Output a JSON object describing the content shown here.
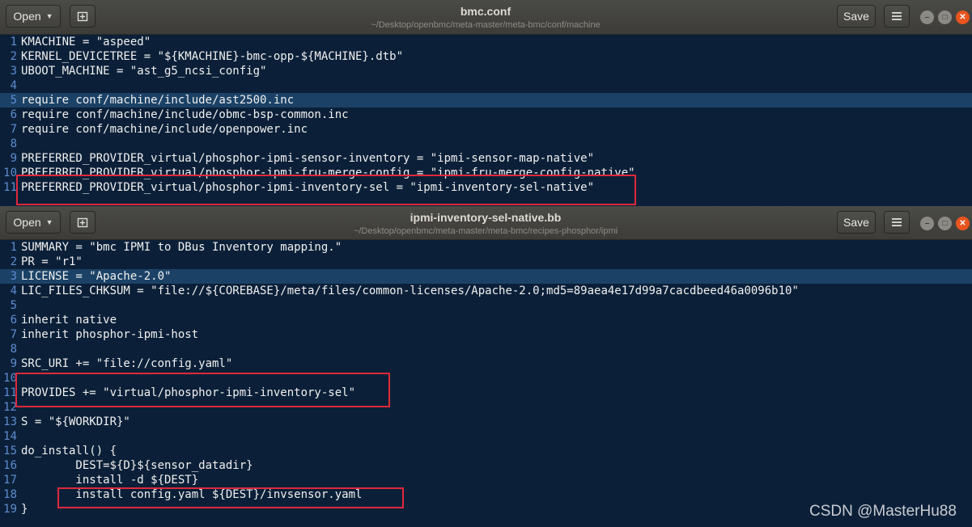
{
  "top_window": {
    "open_label": "Open",
    "title": "bmc.conf",
    "path": "~/Desktop/openbmc/meta-master/meta-bmc/conf/machine",
    "save_label": "Save",
    "lines": [
      {
        "num": "1",
        "text": "KMACHINE = \"aspeed\""
      },
      {
        "num": "2",
        "text": "KERNEL_DEVICETREE = \"${KMACHINE}-bmc-opp-${MACHINE}.dtb\""
      },
      {
        "num": "3",
        "text": "UBOOT_MACHINE = \"ast_g5_ncsi_config\""
      },
      {
        "num": "4",
        "text": ""
      },
      {
        "num": "5",
        "text": "require conf/machine/include/ast2500.inc",
        "current": true
      },
      {
        "num": "6",
        "text": "require conf/machine/include/obmc-bsp-common.inc"
      },
      {
        "num": "7",
        "text": "require conf/machine/include/openpower.inc"
      },
      {
        "num": "8",
        "text": ""
      },
      {
        "num": "9",
        "text": "PREFERRED_PROVIDER_virtual/phosphor-ipmi-sensor-inventory = \"ipmi-sensor-map-native\""
      },
      {
        "num": "10",
        "text": "PREFERRED_PROVIDER_virtual/phosphor-ipmi-fru-merge-config = \"ipmi-fru-merge-config-native\""
      },
      {
        "num": "11",
        "text": "PREFERRED_PROVIDER_virtual/phosphor-ipmi-inventory-sel = \"ipmi-inventory-sel-native\""
      }
    ]
  },
  "bottom_window": {
    "open_label": "Open",
    "title": "ipmi-inventory-sel-native.bb",
    "path": "~/Desktop/openbmc/meta-master/meta-bmc/recipes-phosphor/ipmi",
    "save_label": "Save",
    "lines": [
      {
        "num": "1",
        "text": "SUMMARY = \"bmc IPMI to DBus Inventory mapping.\""
      },
      {
        "num": "2",
        "text": "PR = \"r1\""
      },
      {
        "num": "3",
        "text": "LICENSE = \"Apache-2.0\"",
        "current": true
      },
      {
        "num": "4",
        "text": "LIC_FILES_CHKSUM = \"file://${COREBASE}/meta/files/common-licenses/Apache-2.0;md5=89aea4e17d99a7cacdbeed46a0096b10\""
      },
      {
        "num": "5",
        "text": ""
      },
      {
        "num": "6",
        "text": "inherit native"
      },
      {
        "num": "7",
        "text": "inherit phosphor-ipmi-host"
      },
      {
        "num": "8",
        "text": ""
      },
      {
        "num": "9",
        "text": "SRC_URI += \"file://config.yaml\""
      },
      {
        "num": "10",
        "text": ""
      },
      {
        "num": "11",
        "text": "PROVIDES += \"virtual/phosphor-ipmi-inventory-sel\""
      },
      {
        "num": "12",
        "text": ""
      },
      {
        "num": "13",
        "text": "S = \"${WORKDIR}\""
      },
      {
        "num": "14",
        "text": ""
      },
      {
        "num": "15",
        "text": "do_install() {"
      },
      {
        "num": "16",
        "text": "        DEST=${D}${sensor_datadir}"
      },
      {
        "num": "17",
        "text": "        install -d ${DEST}"
      },
      {
        "num": "18",
        "text": "        install config.yaml ${DEST}/invsensor.yaml"
      },
      {
        "num": "19",
        "text": "}"
      }
    ]
  },
  "watermark": "CSDN @MasterHu88",
  "colors": {
    "editor_bg": "#0b2038",
    "current_line_bg": "#1b4266",
    "line_number": "#5e8cd0",
    "code_text": "#f0f0f0",
    "callout_border": "#e0283c",
    "close_button": "#e9541f"
  },
  "icons": [
    "caret-down-icon",
    "pin-tab-icon",
    "hamburger-menu-icon",
    "minimize-icon",
    "maximize-icon",
    "close-icon"
  ]
}
